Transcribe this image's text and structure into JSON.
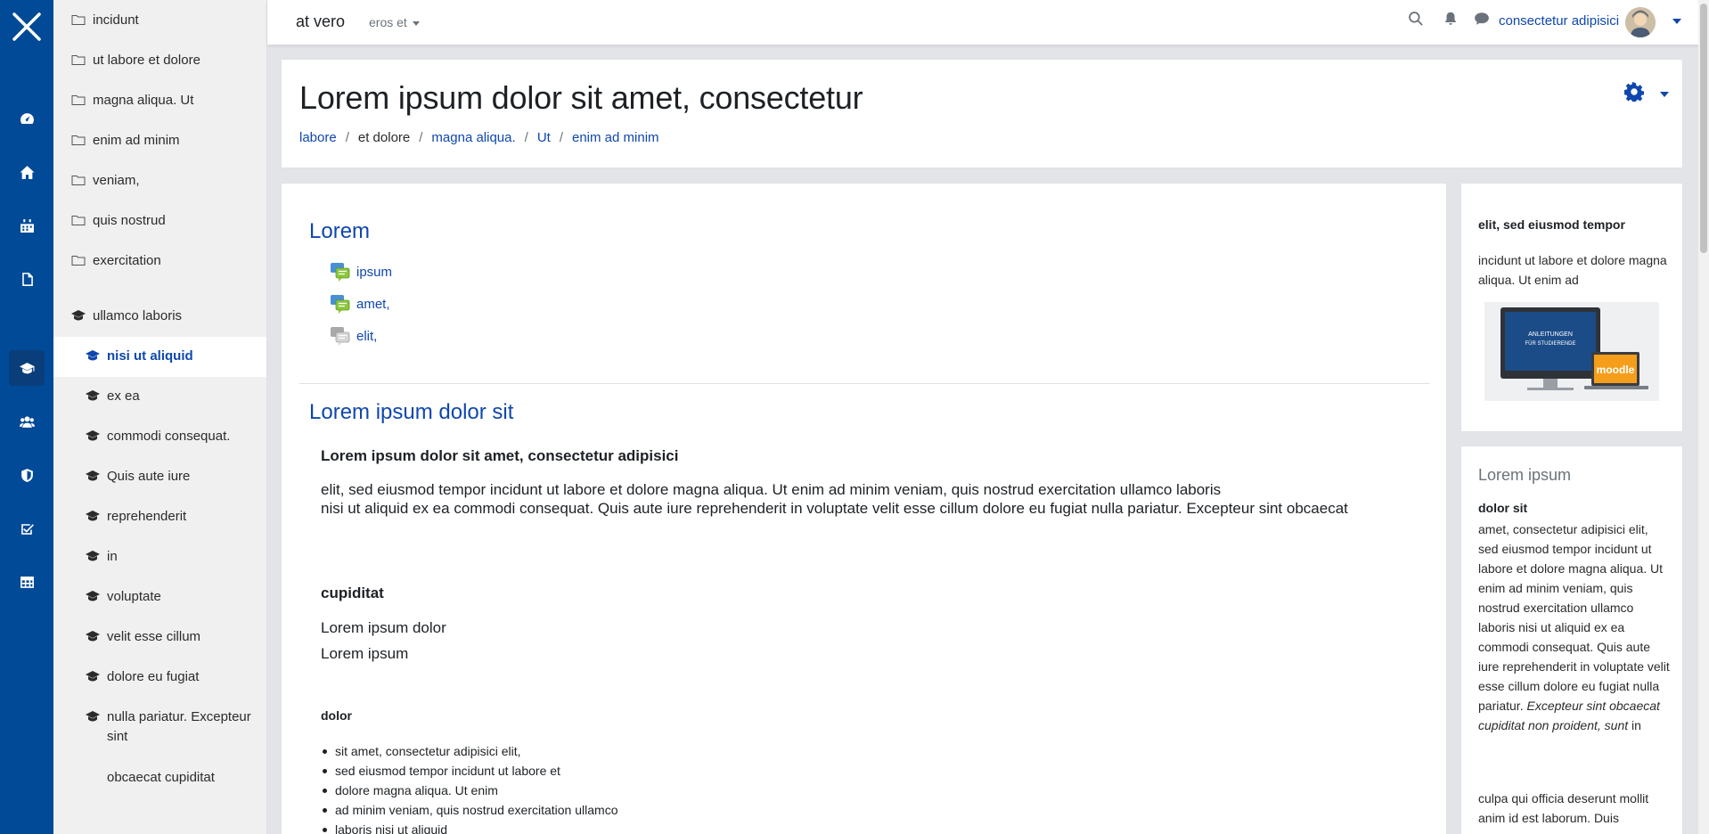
{
  "drawer": {
    "folders": [
      "incidunt",
      "ut labore et dolore",
      "magna aliqua. Ut",
      "enim ad minim",
      "veniam,",
      "quis nostrud",
      "exercitation"
    ],
    "parent_course": "ullamco laboris",
    "active_course": "nisi ut aliquid",
    "courses": [
      "ex ea",
      "commodi consequat.",
      "Quis aute iure",
      "reprehenderit",
      "in",
      "voluptate",
      "velit esse cillum",
      "dolore eu fugiat"
    ],
    "course_multi_line1": "nulla pariatur. Excepteur",
    "course_multi_line2": "sint",
    "last_item": "obcaecat cupiditat"
  },
  "navbar": {
    "site_name": "at vero",
    "lang_menu": "eros et",
    "user_name": "consectetur adipisici"
  },
  "header": {
    "title": "Lorem ipsum dolor sit amet, consectetur",
    "breadcrumb": [
      "labore",
      "et dolore",
      "magna aliqua.",
      "Ut",
      "enim ad minim"
    ]
  },
  "main": {
    "section1_title": "Lorem",
    "activities": [
      "ipsum",
      "amet,",
      "elit,"
    ],
    "section2_title": "Lorem ipsum dolor sit",
    "heading": "Lorem ipsum dolor sit amet, consectetur adipisici",
    "paragraph_line1": "elit, sed eiusmod tempor incidunt ut labore et dolore magna aliqua. Ut enim ad minim veniam, quis nostrud exercitation ullamco laboris",
    "paragraph_line2": "nisi ut aliquid ex ea commodi consequat. Quis aute iure reprehenderit in voluptate velit esse cillum dolore eu fugiat nulla pariatur. Excepteur sint obcaecat",
    "subheading": "cupiditat",
    "line_a": "Lorem ipsum dolor",
    "line_b": "Lorem ipsum",
    "small_heading": "dolor",
    "bullets": [
      "sit amet, consectetur adipisici elit,",
      "sed eiusmod tempor incidunt ut labore et",
      "dolore magna aliqua. Ut enim",
      "ad minim veniam, quis nostrud exercitation ullamco",
      "laboris nisi ut aliquid"
    ]
  },
  "block1": {
    "title": "elit, sed eiusmod tempor",
    "text": "incidunt ut labore et dolore magna aliqua. Ut enim ad",
    "image_line1": "ANLEITUNGEN",
    "image_line2": "FÜR STUDIERENDE",
    "image_logo": "moodle"
  },
  "block2": {
    "title": "Lorem ipsum",
    "subtitle": "dolor sit",
    "text_plain": "amet, consectetur adipisici elit, sed eiusmod tempor incidunt ut labore et dolore magna aliqua. Ut enim ad minim veniam, quis nostrud exercitation ullamco laboris nisi ut aliquid ex ea commodi consequat. Quis aute iure reprehenderit in voluptate velit esse cillum dolore eu fugiat nulla pariatur.",
    "text_italic": "Excepteur sint obcaecat cupiditat non proident, sunt",
    "text_end": "in",
    "text2": "culpa qui officia deserunt mollit anim id est laborum. Duis"
  },
  "colors": {
    "rail": "#004a97",
    "link": "#0f47ad",
    "drawer": "#f0f0f0"
  },
  "icons": {
    "rail": [
      "close-icon",
      "dashboard-icon",
      "home-icon",
      "calendar-icon",
      "file-icon",
      "graduation-cap-icon",
      "users-icon",
      "shield-icon",
      "check-square-icon",
      "table-icon"
    ],
    "navbar": [
      "search-icon",
      "bell-icon",
      "message-icon"
    ]
  }
}
